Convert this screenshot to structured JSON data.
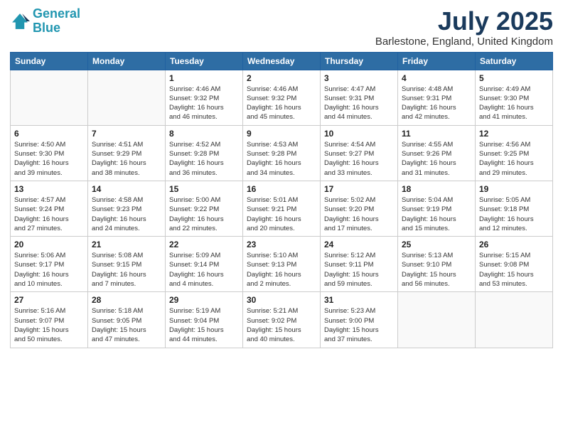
{
  "logo": {
    "line1": "General",
    "line2": "Blue"
  },
  "title": "July 2025",
  "subtitle": "Barlestone, England, United Kingdom",
  "days_of_week": [
    "Sunday",
    "Monday",
    "Tuesday",
    "Wednesday",
    "Thursday",
    "Friday",
    "Saturday"
  ],
  "weeks": [
    [
      {
        "day": "",
        "info": ""
      },
      {
        "day": "",
        "info": ""
      },
      {
        "day": "1",
        "info": "Sunrise: 4:46 AM\nSunset: 9:32 PM\nDaylight: 16 hours\nand 46 minutes."
      },
      {
        "day": "2",
        "info": "Sunrise: 4:46 AM\nSunset: 9:32 PM\nDaylight: 16 hours\nand 45 minutes."
      },
      {
        "day": "3",
        "info": "Sunrise: 4:47 AM\nSunset: 9:31 PM\nDaylight: 16 hours\nand 44 minutes."
      },
      {
        "day": "4",
        "info": "Sunrise: 4:48 AM\nSunset: 9:31 PM\nDaylight: 16 hours\nand 42 minutes."
      },
      {
        "day": "5",
        "info": "Sunrise: 4:49 AM\nSunset: 9:30 PM\nDaylight: 16 hours\nand 41 minutes."
      }
    ],
    [
      {
        "day": "6",
        "info": "Sunrise: 4:50 AM\nSunset: 9:30 PM\nDaylight: 16 hours\nand 39 minutes."
      },
      {
        "day": "7",
        "info": "Sunrise: 4:51 AM\nSunset: 9:29 PM\nDaylight: 16 hours\nand 38 minutes."
      },
      {
        "day": "8",
        "info": "Sunrise: 4:52 AM\nSunset: 9:28 PM\nDaylight: 16 hours\nand 36 minutes."
      },
      {
        "day": "9",
        "info": "Sunrise: 4:53 AM\nSunset: 9:28 PM\nDaylight: 16 hours\nand 34 minutes."
      },
      {
        "day": "10",
        "info": "Sunrise: 4:54 AM\nSunset: 9:27 PM\nDaylight: 16 hours\nand 33 minutes."
      },
      {
        "day": "11",
        "info": "Sunrise: 4:55 AM\nSunset: 9:26 PM\nDaylight: 16 hours\nand 31 minutes."
      },
      {
        "day": "12",
        "info": "Sunrise: 4:56 AM\nSunset: 9:25 PM\nDaylight: 16 hours\nand 29 minutes."
      }
    ],
    [
      {
        "day": "13",
        "info": "Sunrise: 4:57 AM\nSunset: 9:24 PM\nDaylight: 16 hours\nand 27 minutes."
      },
      {
        "day": "14",
        "info": "Sunrise: 4:58 AM\nSunset: 9:23 PM\nDaylight: 16 hours\nand 24 minutes."
      },
      {
        "day": "15",
        "info": "Sunrise: 5:00 AM\nSunset: 9:22 PM\nDaylight: 16 hours\nand 22 minutes."
      },
      {
        "day": "16",
        "info": "Sunrise: 5:01 AM\nSunset: 9:21 PM\nDaylight: 16 hours\nand 20 minutes."
      },
      {
        "day": "17",
        "info": "Sunrise: 5:02 AM\nSunset: 9:20 PM\nDaylight: 16 hours\nand 17 minutes."
      },
      {
        "day": "18",
        "info": "Sunrise: 5:04 AM\nSunset: 9:19 PM\nDaylight: 16 hours\nand 15 minutes."
      },
      {
        "day": "19",
        "info": "Sunrise: 5:05 AM\nSunset: 9:18 PM\nDaylight: 16 hours\nand 12 minutes."
      }
    ],
    [
      {
        "day": "20",
        "info": "Sunrise: 5:06 AM\nSunset: 9:17 PM\nDaylight: 16 hours\nand 10 minutes."
      },
      {
        "day": "21",
        "info": "Sunrise: 5:08 AM\nSunset: 9:15 PM\nDaylight: 16 hours\nand 7 minutes."
      },
      {
        "day": "22",
        "info": "Sunrise: 5:09 AM\nSunset: 9:14 PM\nDaylight: 16 hours\nand 4 minutes."
      },
      {
        "day": "23",
        "info": "Sunrise: 5:10 AM\nSunset: 9:13 PM\nDaylight: 16 hours\nand 2 minutes."
      },
      {
        "day": "24",
        "info": "Sunrise: 5:12 AM\nSunset: 9:11 PM\nDaylight: 15 hours\nand 59 minutes."
      },
      {
        "day": "25",
        "info": "Sunrise: 5:13 AM\nSunset: 9:10 PM\nDaylight: 15 hours\nand 56 minutes."
      },
      {
        "day": "26",
        "info": "Sunrise: 5:15 AM\nSunset: 9:08 PM\nDaylight: 15 hours\nand 53 minutes."
      }
    ],
    [
      {
        "day": "27",
        "info": "Sunrise: 5:16 AM\nSunset: 9:07 PM\nDaylight: 15 hours\nand 50 minutes."
      },
      {
        "day": "28",
        "info": "Sunrise: 5:18 AM\nSunset: 9:05 PM\nDaylight: 15 hours\nand 47 minutes."
      },
      {
        "day": "29",
        "info": "Sunrise: 5:19 AM\nSunset: 9:04 PM\nDaylight: 15 hours\nand 44 minutes."
      },
      {
        "day": "30",
        "info": "Sunrise: 5:21 AM\nSunset: 9:02 PM\nDaylight: 15 hours\nand 40 minutes."
      },
      {
        "day": "31",
        "info": "Sunrise: 5:23 AM\nSunset: 9:00 PM\nDaylight: 15 hours\nand 37 minutes."
      },
      {
        "day": "",
        "info": ""
      },
      {
        "day": "",
        "info": ""
      }
    ]
  ]
}
